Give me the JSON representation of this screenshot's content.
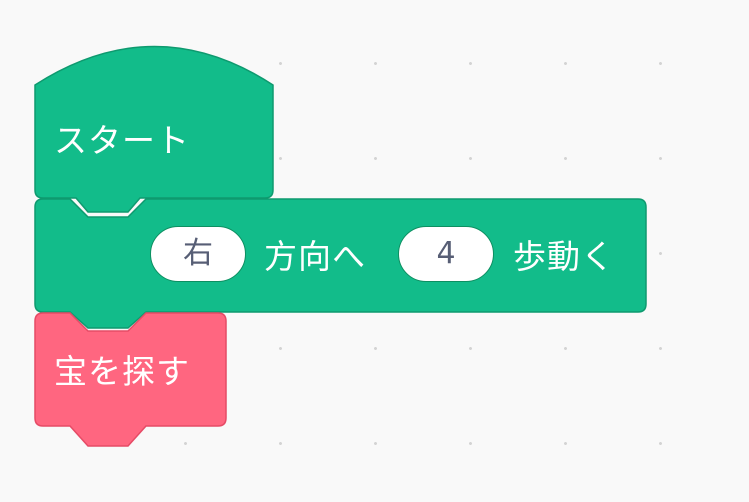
{
  "blocks": {
    "start": {
      "label": "スタート",
      "color": "#12bc8a",
      "border_color": "#0e9a6f"
    },
    "move": {
      "direction_value": "右",
      "direction_suffix": "方向へ",
      "steps_value": "4",
      "steps_suffix": "歩動く",
      "color": "#12bc8a",
      "border_color": "#0e9a6f"
    },
    "find_treasure": {
      "label": "宝を探す",
      "color": "#ff6680",
      "border_color": "#e64b66"
    }
  }
}
